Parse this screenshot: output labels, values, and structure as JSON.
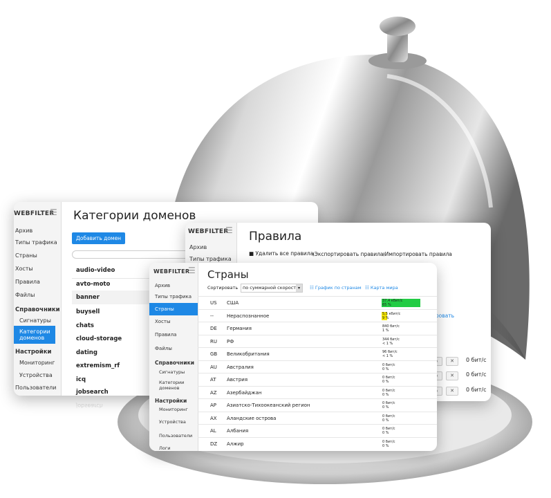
{
  "colors": {
    "accent": "#1e88e5",
    "bar_green": "#22cc44",
    "bar_yellow": "#f2e400"
  },
  "win1": {
    "brand": "WEBFILTER",
    "title": "Категории доменов",
    "add_button": "Добавить домен",
    "nav": [
      "Архив",
      "Типы трафика",
      "Страны",
      "Хосты",
      "Правила",
      "Файлы"
    ],
    "section_ref": "Справочники",
    "sub_ref": [
      "Сигнатуры",
      "Категории доменов"
    ],
    "section_settings": "Настройки",
    "sub_settings": [
      "Мониторинг",
      "Устройства",
      "Пользователи"
    ],
    "categories": [
      "audio-video",
      "avto-moto",
      "banner",
      "buysell",
      "chats",
      "cloud-storage",
      "dating",
      "extremism_rf",
      "icq",
      "jobsearch"
    ]
  },
  "win2": {
    "brand": "WEBFILTER",
    "nav": [
      "Архив",
      "Типы трафика"
    ],
    "title": "Правила",
    "actions": [
      "Удалить все правила",
      "Экспортировать правила",
      "Импортировать правила"
    ],
    "partial_link": "ировать",
    "rates": [
      "0 бит/с",
      "0 бит/с",
      "0 бит/с"
    ]
  },
  "win3": {
    "brand": "WEBFILTER",
    "nav": [
      "Архив",
      "Типы трафика",
      "Страны",
      "Хосты",
      "Правила",
      "Файлы"
    ],
    "section_ref": "Справочники",
    "sub_ref": [
      "Сигнатуры",
      "Категории доменов"
    ],
    "section_settings": "Настройки",
    "sub_settings": [
      "Мониторинг",
      "Устройства",
      "Пользователи",
      "Логи"
    ],
    "title": "Страны",
    "sort_label": "Сортировать",
    "sort_value": "по суммарной скорости",
    "chart_link": "График по странам",
    "map_link": "Карта мира",
    "countries": [
      {
        "code": "US",
        "name": "США",
        "speed": "37,4 кбит/с",
        "pct": "65 %",
        "fill": 1.0,
        "color": "green"
      },
      {
        "code": "--",
        "name": "Нераспознанное",
        "speed": "5,5 кбит/с",
        "pct": "9 %",
        "fill": 0.15,
        "color": "yellow"
      },
      {
        "code": "DE",
        "name": "Германия",
        "speed": "840 бит/с",
        "pct": "1 %",
        "fill": 0,
        "color": "none"
      },
      {
        "code": "RU",
        "name": "РФ",
        "speed": "344 бит/с",
        "pct": "< 1 %",
        "fill": 0,
        "color": "none"
      },
      {
        "code": "GB",
        "name": "Великобритания",
        "speed": "96 бит/с",
        "pct": "< 1 %",
        "fill": 0,
        "color": "none"
      },
      {
        "code": "AU",
        "name": "Австралия",
        "speed": "0 бит/с",
        "pct": "0 %",
        "fill": 0,
        "color": "none"
      },
      {
        "code": "AT",
        "name": "Австрия",
        "speed": "0 бит/с",
        "pct": "0 %",
        "fill": 0,
        "color": "none"
      },
      {
        "code": "AZ",
        "name": "Азербайджан",
        "speed": "0 бит/с",
        "pct": "0 %",
        "fill": 0,
        "color": "none"
      },
      {
        "code": "AP",
        "name": "Азиатско-Тихоокеанский регион",
        "speed": "0 бит/с",
        "pct": "0 %",
        "fill": 0,
        "color": "none"
      },
      {
        "code": "AX",
        "name": "Аландские острова",
        "speed": "0 бит/с",
        "pct": "0 %",
        "fill": 0,
        "color": "none"
      },
      {
        "code": "AL",
        "name": "Албания",
        "speed": "0 бит/с",
        "pct": "0 %",
        "fill": 0,
        "color": "none"
      },
      {
        "code": "DZ",
        "name": "Алжир",
        "speed": "0 бит/с",
        "pct": "0 %",
        "fill": 0,
        "color": "none"
      }
    ]
  }
}
